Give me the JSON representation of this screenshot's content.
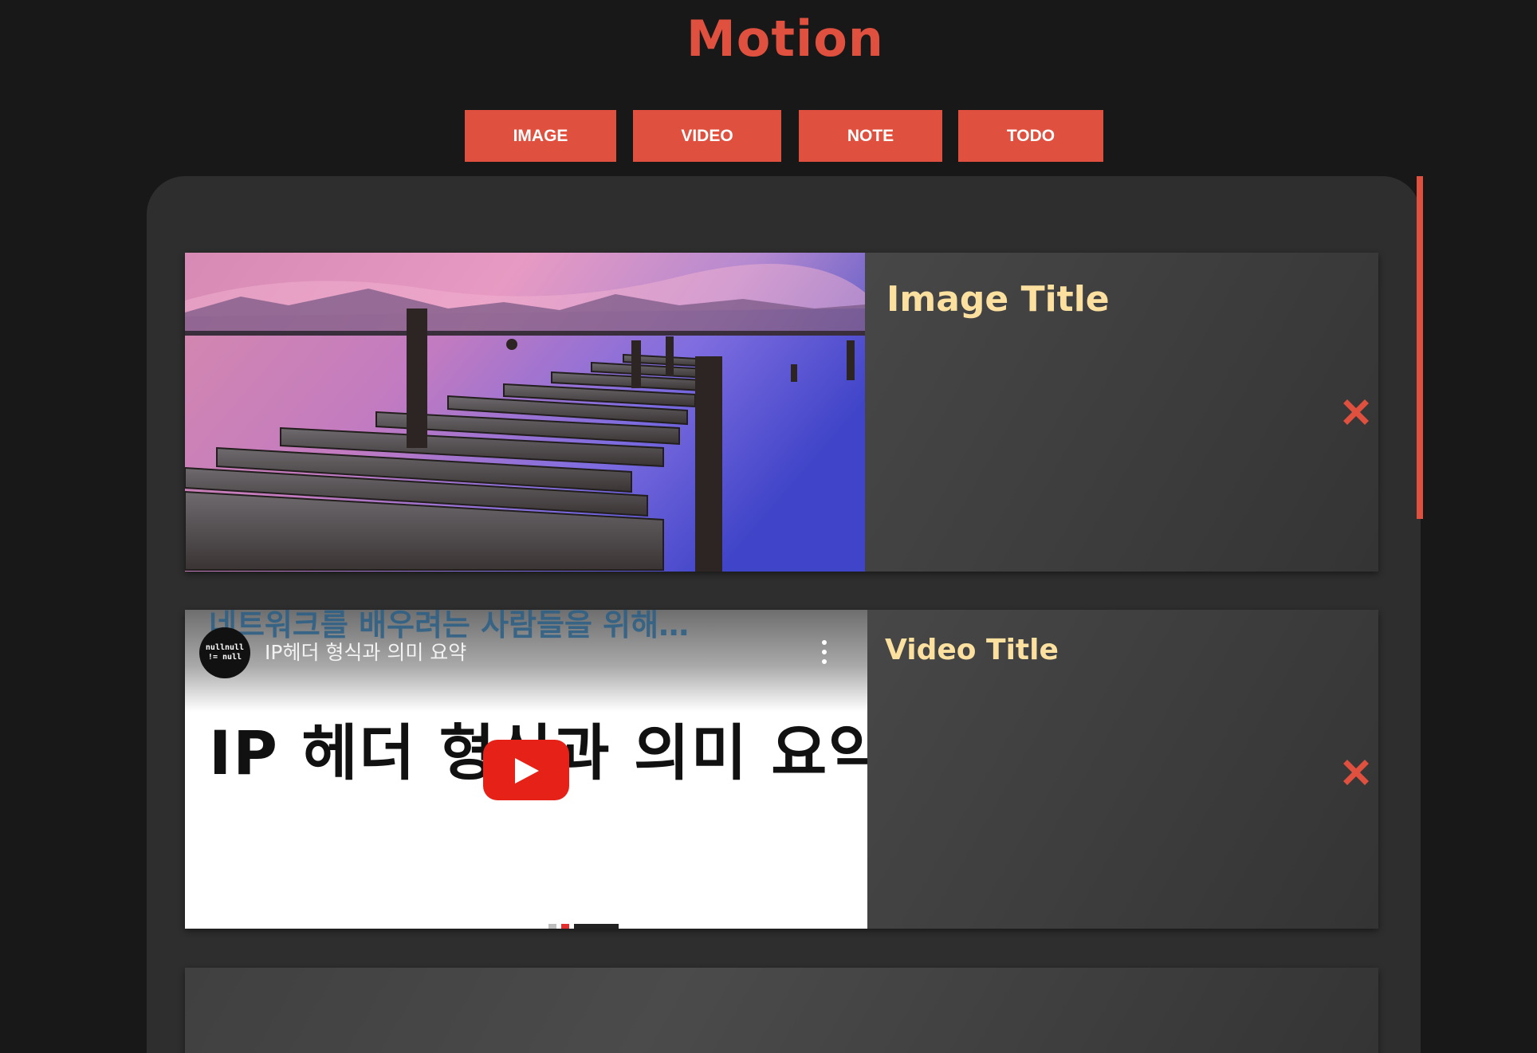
{
  "header": {
    "title": "Motion"
  },
  "controls": {
    "image": "IMAGE",
    "video": "VIDEO",
    "note": "NOTE",
    "todo": "TODO"
  },
  "items": [
    {
      "type": "image",
      "title": "Image Title"
    },
    {
      "type": "video",
      "title": "Video Title",
      "embed": {
        "overlay_text": "네트워크를 배우려는 사람들을 위해…",
        "channel_avatar_line1": "nullnull",
        "channel_avatar_line2": "!= null",
        "video_title": "IP헤더 형식과 의미 요약",
        "thumbnail_text": "IP 헤더 형식과 의미 요약"
      }
    }
  ],
  "colors": {
    "accent": "#e0503e",
    "title": "#fbe0a0",
    "background": "#181818",
    "panel": "#2e2e2e"
  }
}
